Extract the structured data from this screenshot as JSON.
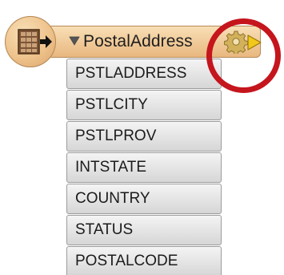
{
  "reader": {
    "title": "PostalAddress",
    "icons": {
      "badge": "table-icon",
      "badge_arrow": "arrow-right-icon",
      "collapse": "triangle-down-icon",
      "parameters": "gear-icon",
      "output_port": "output-port-icon"
    },
    "colors": {
      "header": "#eec28b",
      "attribute_fill": "#e4e4e4",
      "highlight": "#c5151d",
      "port": "#f2c81b"
    }
  },
  "attributes": [
    {
      "label": "PSTLADDRESS"
    },
    {
      "label": "PSTLCITY"
    },
    {
      "label": "PSTLPROV"
    },
    {
      "label": "INTSTATE"
    },
    {
      "label": "COUNTRY"
    },
    {
      "label": "STATUS"
    },
    {
      "label": "POSTALCODE"
    }
  ]
}
